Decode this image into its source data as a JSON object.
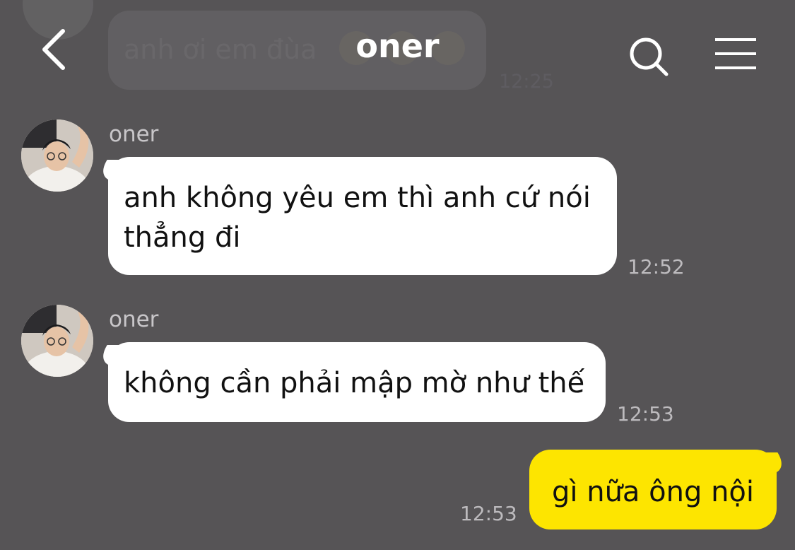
{
  "header": {
    "title": "oner",
    "icons": {
      "back": "chevron-left-icon",
      "search": "search-icon",
      "menu": "hamburger-menu-icon"
    }
  },
  "faded_message": {
    "text": "anh ơi em đùa",
    "time": "12:25"
  },
  "messages": [
    {
      "sender": "oner",
      "text_lines": [
        "anh không yêu em thì anh cứ nói",
        "thẳng đi"
      ],
      "time": "12:52",
      "direction": "incoming"
    },
    {
      "sender": "oner",
      "text_lines": [
        "không cần phải mập mờ như thế"
      ],
      "time": "12:53",
      "direction": "incoming"
    },
    {
      "text_lines": [
        "gì nữa ông nội"
      ],
      "time": "12:53",
      "direction": "outgoing"
    }
  ],
  "colors": {
    "background": "#565456",
    "incoming_bubble": "#ffffff",
    "outgoing_bubble": "#fde500",
    "timestamp": "#bdbbbe"
  }
}
